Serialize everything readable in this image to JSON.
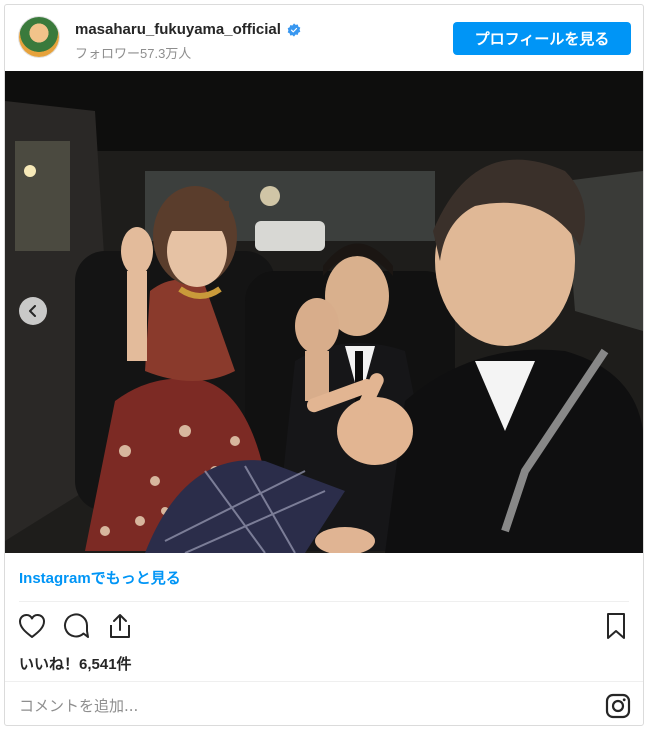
{
  "post": {
    "username": "masaharu_fukuyama_official",
    "followers": "フォロワー57.3万人",
    "profile_button": "プロフィールを見る",
    "more_link": "Instagramでもっと見る",
    "likes": "いいね！6,541件",
    "comment_placeholder": "コメントを追加..."
  },
  "icons": {
    "verified": "verified-badge-icon",
    "heart": "heart-icon",
    "comment": "comment-icon",
    "share": "share-icon",
    "save": "bookmark-icon",
    "instagram": "instagram-icon",
    "carousel_prev": "chevron-left-icon"
  },
  "colors": {
    "accent": "#0095f6",
    "text": "#262626",
    "muted": "#8e8e8e"
  }
}
